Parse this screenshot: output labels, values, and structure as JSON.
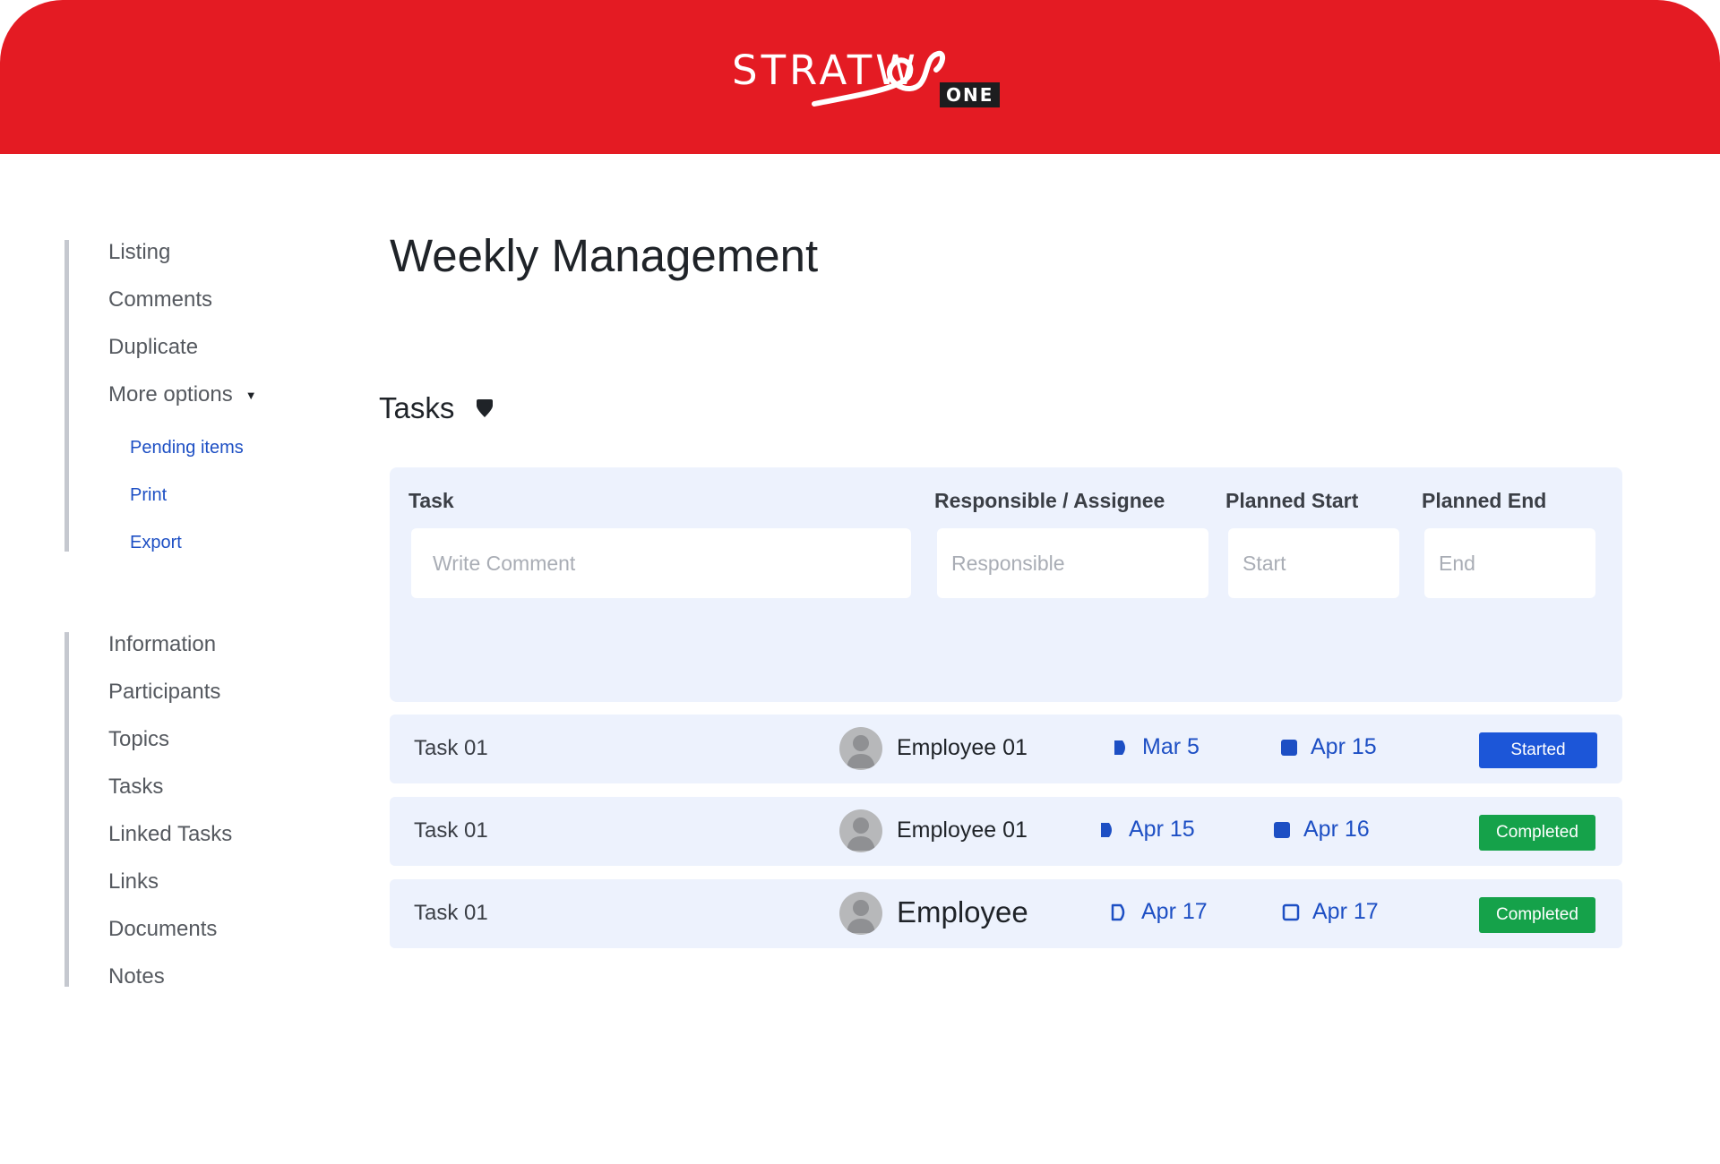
{
  "brand": {
    "logo_text": "STRATW",
    "logo_badge": "ONE",
    "header_color": "#e41b23"
  },
  "sidebar": {
    "group1": [
      {
        "label": "Listing"
      },
      {
        "label": "Comments"
      },
      {
        "label": "Duplicate"
      },
      {
        "label": "More options",
        "caret": "▼"
      }
    ],
    "more_options_items": [
      {
        "label": "Pending items"
      },
      {
        "label": "Print"
      },
      {
        "label": "Export"
      }
    ],
    "group2": [
      {
        "label": "Information"
      },
      {
        "label": "Participants"
      },
      {
        "label": "Topics"
      },
      {
        "label": "Tasks"
      },
      {
        "label": "Linked Tasks"
      },
      {
        "label": "Links"
      },
      {
        "label": "Documents"
      },
      {
        "label": "Notes"
      }
    ]
  },
  "page": {
    "title": "Weekly Management"
  },
  "tasks_section": {
    "title": "Tasks",
    "columns": {
      "task": "Task",
      "responsible": "Responsible / Assignee",
      "planned_start": "Planned Start",
      "planned_end": "Planned End"
    },
    "placeholders": {
      "task": "Write Comment",
      "responsible": "Responsible",
      "start": "Start",
      "end": "End"
    },
    "rows": [
      {
        "task": "Task 01",
        "employee": "Employee 01",
        "start": "Mar 5",
        "end": "Apr 15",
        "status": "Started",
        "status_color": "#1c56d8"
      },
      {
        "task": "Task 01",
        "employee": "Employee 01",
        "start": "Apr 15",
        "end": "Apr 16",
        "status": "Completed",
        "status_color": "#15a24a"
      },
      {
        "task": "Task 01",
        "employee": "Employee",
        "start": "Apr 17",
        "end": "Apr 17",
        "status": "Completed",
        "status_color": "#15a24a"
      }
    ]
  },
  "colors": {
    "link_blue": "#1d4fc4",
    "panel_bg": "#edf2fd"
  }
}
